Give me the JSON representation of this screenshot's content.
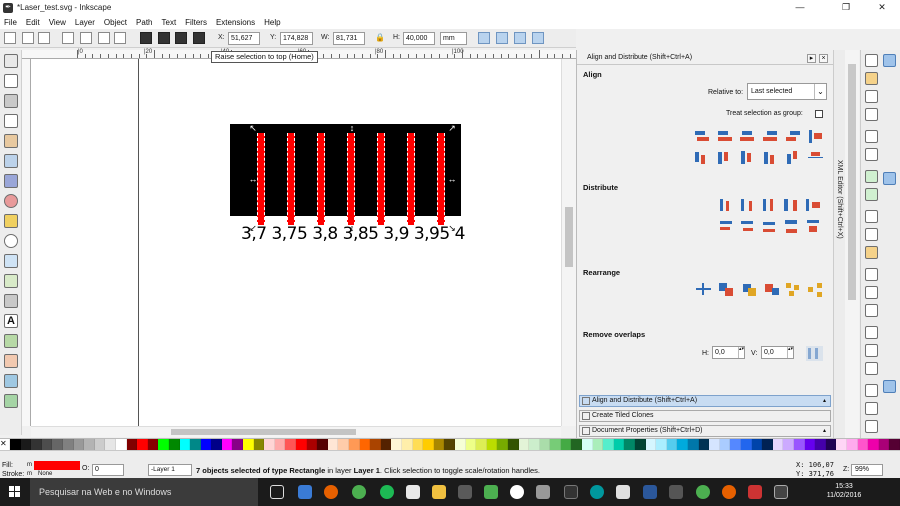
{
  "window": {
    "title": "*Laser_test.svg - Inkscape",
    "minimize": "—",
    "maximize": "❐",
    "close": "✕"
  },
  "menu": [
    "File",
    "Edit",
    "View",
    "Layer",
    "Object",
    "Path",
    "Text",
    "Filters",
    "Extensions",
    "Help"
  ],
  "controls": {
    "x_label": "X:",
    "x_value": "51,627",
    "y_label": "Y:",
    "y_value": "174,828",
    "w_label": "W:",
    "w_value": "81,731",
    "h_label": "H:",
    "h_value": "40,000",
    "unit": "mm",
    "tooltip": "Raise selection to top (Home)"
  },
  "ruler": {
    "labels": [
      "|0",
      "|20",
      "|40",
      "|60",
      "|80",
      "|100"
    ]
  },
  "canvas": {
    "labels": "3,7 3,75 3,8 3,85 3,9 3,95 4",
    "bar_count": 7,
    "fill_color": "#ff0000"
  },
  "panel": {
    "title": "Align and Distribute (Shift+Ctrl+A)",
    "align": "Align",
    "relative_label": "Relative to:",
    "relative_value": "Last selected",
    "treat_label": "Treat selection as group:",
    "distribute": "Distribute",
    "rearrange": "Rearrange",
    "remove_overlaps": "Remove overlaps",
    "h_label": "H:",
    "h_value": "0,0",
    "v_label": "V:",
    "v_value": "0,0",
    "tabs": [
      "Align and Distribute (Shift+Ctrl+A)",
      "Create Tiled Clones",
      "Document Properties (Shift+Ctrl+D)"
    ]
  },
  "xml_tab": "XML Editor (Shift+Ctrl+X)",
  "status": {
    "fill_label": "Fill:",
    "stroke_label": "Stroke:",
    "fill_m": "m",
    "stroke_m": "m",
    "stroke_value": "None",
    "opacity_label": "O:",
    "opacity_value": "0",
    "layer": "-Layer 1",
    "message_count": "7 objects selected of type",
    "message_type": "Rectangle",
    "message_mid": "in layer",
    "message_layer": "Layer 1",
    "message_end": ". Click selection to toggle scale/rotation handles.",
    "x_readout": "X: 106,07",
    "y_readout": "Y: 371,76",
    "zoom_label": "Z:",
    "zoom_value": "99%"
  },
  "taskbar": {
    "search_placeholder": "Pesquisar na Web e no Windows",
    "time": "15:33",
    "date": "11/02/2016"
  },
  "colors": {
    "accent": "#2f6bb6",
    "selection": "#c8dcf2",
    "red": "#ff0000"
  }
}
